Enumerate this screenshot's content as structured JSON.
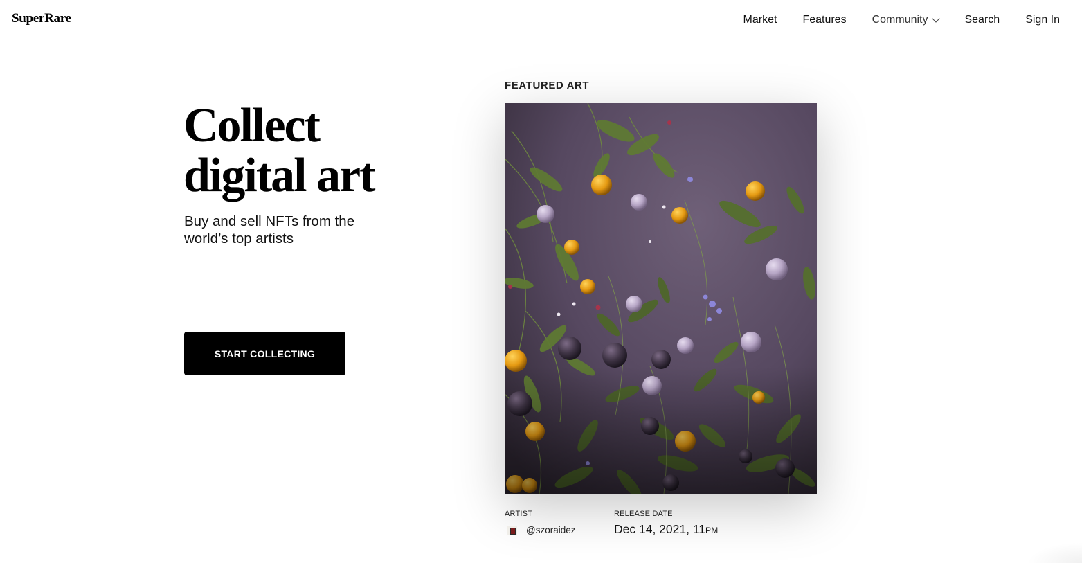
{
  "header": {
    "logo": "SuperRare",
    "nav": {
      "market": "Market",
      "features": "Features",
      "community": "Community",
      "search": "Search",
      "sign_in": "Sign In"
    }
  },
  "hero": {
    "title_line1": "Collect",
    "title_line2": "digital art",
    "subtitle_line1": "Buy and sell NFTs from the",
    "subtitle_line2": "world’s top artists",
    "cta_label": "START COLLECTING"
  },
  "featured": {
    "section_label": "FEATURED ART",
    "artwork_icon": "floral-artwork-image",
    "artist_label": "ARTIST",
    "artist_handle": "@szoraidez",
    "release_label": "RELEASE DATE",
    "release_date": "Dec 14, 2021, 11",
    "release_ampm": "PM"
  },
  "colors": {
    "background": "#ffffff",
    "text": "#000000",
    "cta_bg": "#000000",
    "cta_text": "#ffffff",
    "artwork_bg": "#5e4f66"
  }
}
